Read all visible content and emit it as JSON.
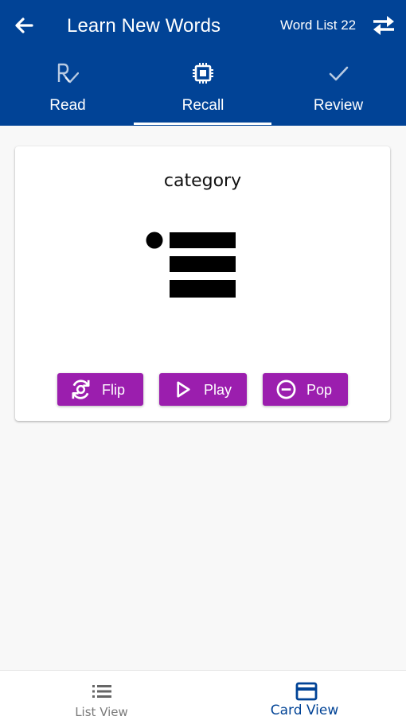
{
  "header": {
    "title": "Learn New Words",
    "word_list": "Word List 22"
  },
  "tabs": [
    {
      "label": "Read",
      "icon": "read-icon",
      "selected": false
    },
    {
      "label": "Recall",
      "icon": "chip-icon",
      "selected": true
    },
    {
      "label": "Review",
      "icon": "check-icon",
      "selected": false
    }
  ],
  "card": {
    "word": "category",
    "image_icon": "category-list-icon",
    "buttons": {
      "flip": "Flip",
      "play": "Play",
      "pop": "Pop"
    }
  },
  "bottom_nav": {
    "list_view": "List View",
    "card_view": "Card View",
    "selected": "card_view"
  },
  "colors": {
    "primary": "#014396",
    "button": "#9b1eae",
    "background": "#f8f8f8"
  }
}
